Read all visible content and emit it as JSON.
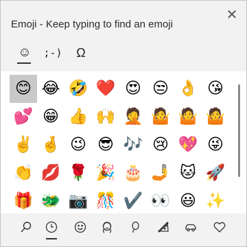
{
  "title": "Emoji - Keep typing to find an emoji",
  "close_glyph": "✕",
  "tabs": [
    {
      "name": "emoji-tab",
      "glyph": "☺"
    },
    {
      "name": "kaomoji-tab",
      "glyph": ";-)"
    },
    {
      "name": "symbols-tab",
      "glyph": "Ω"
    }
  ],
  "emoji_grid": [
    [
      "😊",
      "😂",
      "🤣",
      "❤️",
      "😍",
      "😒",
      "👌",
      "😘"
    ],
    [
      "💕",
      "😁",
      "👍",
      "🙌",
      "🤦",
      "🤷",
      "🤷",
      "🤷"
    ],
    [
      "✌️",
      "🤞",
      "😉",
      "😎",
      "🎶",
      "😢",
      "💖",
      "😜"
    ],
    [
      "👏",
      "💋",
      "🌹",
      "🎉",
      "🎂",
      "🤳",
      "🐱",
      "🚀"
    ],
    [
      "🎁",
      "🐲",
      "📷",
      "🎊",
      "✔️",
      "👀",
      "😃",
      "✨"
    ]
  ],
  "category_bar": [
    {
      "icon": "search-icon"
    },
    {
      "icon": "recent-clock-icon"
    },
    {
      "icon": "smiley-icon"
    },
    {
      "icon": "people-icon"
    },
    {
      "icon": "celebration-icon"
    },
    {
      "icon": "food-icon"
    },
    {
      "icon": "travel-car-icon"
    },
    {
      "icon": "heart-icon"
    }
  ]
}
